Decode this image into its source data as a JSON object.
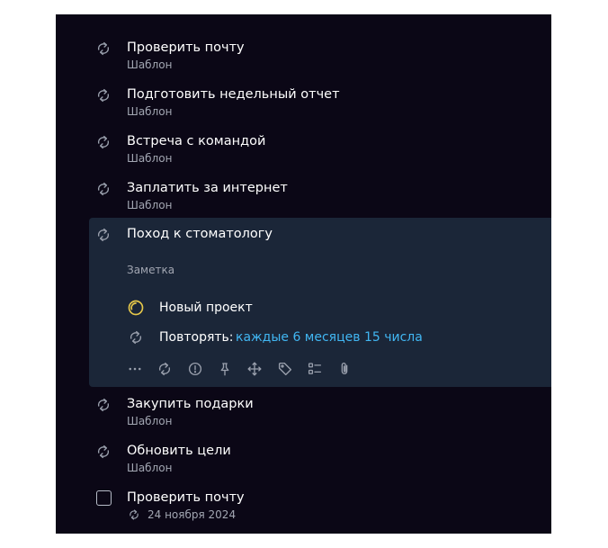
{
  "tasks_before": [
    {
      "title": "Проверить почту",
      "subtitle": "Шаблон"
    },
    {
      "title": "Подготовить недельный отчет",
      "subtitle": "Шаблон"
    },
    {
      "title": "Встреча с командой",
      "subtitle": "Шаблон"
    },
    {
      "title": "Заплатить за интернет",
      "subtitle": "Шаблон"
    }
  ],
  "expanded_task": {
    "title": "Поход к стоматологу",
    "note_placeholder": "Заметка",
    "project": "Новый проект",
    "repeat_label": "Повторять:",
    "repeat_value": "каждые 6 месяцев 15 числа",
    "toolbar_icons": [
      "more-icon",
      "repeat-icon",
      "priority-icon",
      "pin-icon",
      "move-icon",
      "tag-icon",
      "checklist-icon",
      "attachment-icon"
    ]
  },
  "tasks_after": [
    {
      "title": "Закупить подарки",
      "subtitle": "Шаблон"
    },
    {
      "title": "Обновить цели",
      "subtitle": "Шаблон"
    }
  ],
  "last_task": {
    "title": "Проверить почту",
    "date": "24 ноября 2024"
  },
  "colors": {
    "panel_bg": "#0b0716",
    "expanded_bg": "#1b2638",
    "accent_blue": "#41b6f2",
    "project_yellow": "#e6c84a",
    "muted_text": "#a2a6b2"
  }
}
